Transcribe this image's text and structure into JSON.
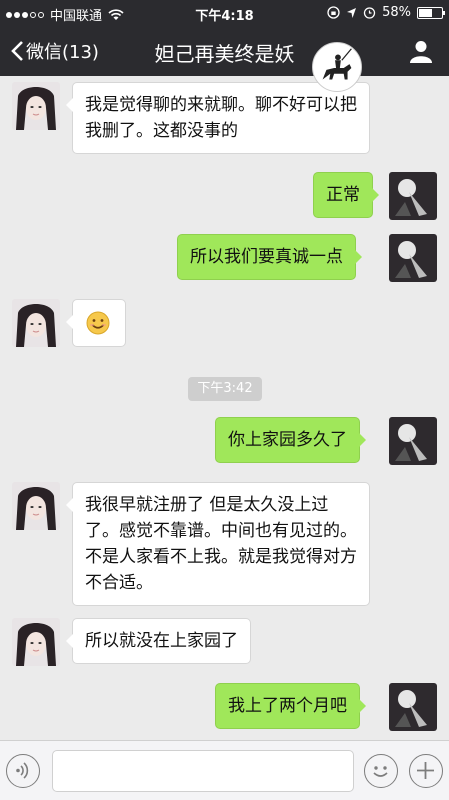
{
  "status_bar": {
    "carrier": "中国联通",
    "time": "下午4:18",
    "battery": "58%",
    "battery_level": 0.58
  },
  "nav": {
    "back_label": "微信(13)",
    "title": "妲己再美终是妖"
  },
  "messages": [
    {
      "side": "left",
      "text": "我是觉得聊的来就聊。聊不好可以把我删了。这都没事的"
    },
    {
      "side": "right",
      "text": "正常"
    },
    {
      "side": "right",
      "text": "所以我们要真诚一点"
    },
    {
      "side": "left",
      "text": "😊",
      "type": "emoji"
    },
    {
      "type": "timestamp",
      "text": "下午3:42"
    },
    {
      "side": "right",
      "text": "你上家园多久了"
    },
    {
      "side": "left",
      "text": "我很早就注册了 但是太久没上过了。感觉不靠谱。中间也有见过的。不是人家看不上我。就是我觉得对方不合适。"
    },
    {
      "side": "left",
      "text": "所以就没在上家园了"
    },
    {
      "side": "right",
      "text": "我上了两个月吧"
    }
  ],
  "input_bar": {
    "voice_icon": "voice-icon",
    "emoji_icon": "emoji-icon",
    "plus_icon": "plus-icon",
    "placeholder": ""
  },
  "colors": {
    "bar": "#2b2b2f",
    "chat_bg": "#ebebeb",
    "my_bubble": "#a0e75a",
    "their_bubble": "#ffffff"
  }
}
